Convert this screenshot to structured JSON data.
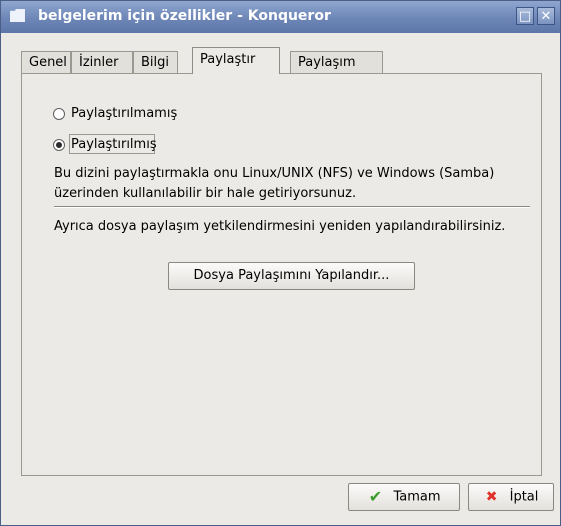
{
  "window": {
    "title": "belgelerim için özellikler - Konqueror",
    "controls": [
      "□",
      "✕"
    ]
  },
  "tabs": [
    {
      "label": "Genel"
    },
    {
      "label": "İzinler"
    },
    {
      "label": "Bilgi"
    },
    {
      "label": "Paylaştır",
      "active": true
    },
    {
      "label": "Paylaşım"
    }
  ],
  "share": {
    "option_not_shared": "Paylaştırılmamış",
    "option_shared": "Paylaştırılmış",
    "selected": "Paylaştırılmış",
    "description": "Bu dizini paylaştırmakla onu Linux/UNIX (NFS) ve Windows (Samba) üzerinden kullanılabilir bir hale getiriyorsunuz.",
    "config_hint": "Ayrıca dosya paylaşım yetkilendirmesini yeniden yapılandırabilirsiniz.",
    "configure_button": "Dosya Paylaşımını Yapılandır..."
  },
  "footer": {
    "ok_label": "Tamam",
    "cancel_label": "İptal",
    "ok_icon": "checkmark-icon",
    "cancel_icon": "x-icon"
  }
}
